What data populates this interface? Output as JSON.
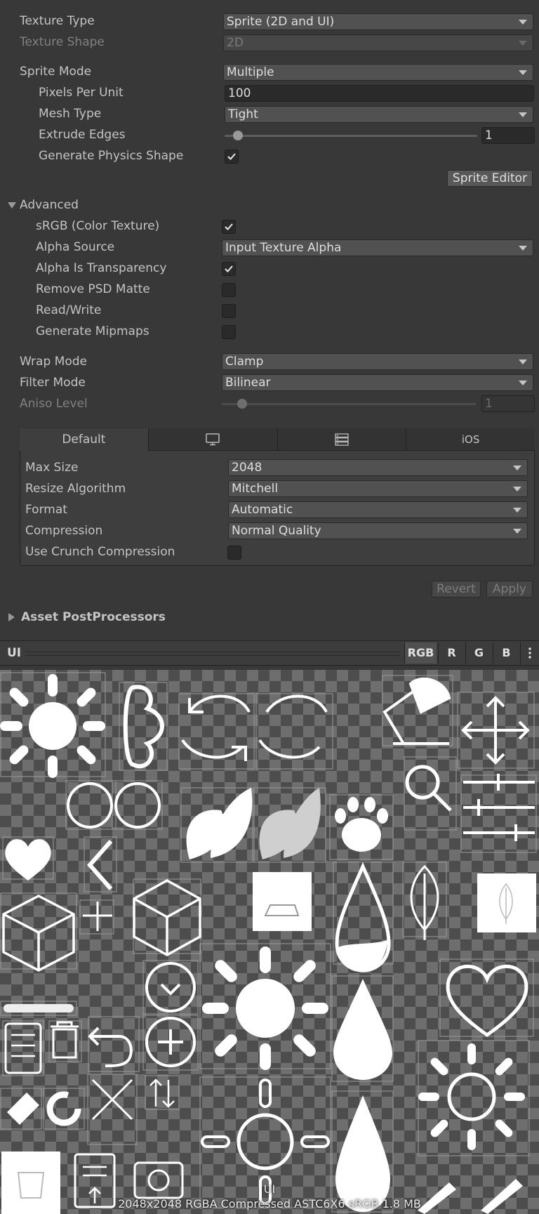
{
  "importer": {
    "texture_type": {
      "label": "Texture Type",
      "value": "Sprite (2D and UI)"
    },
    "texture_shape": {
      "label": "Texture Shape",
      "value": "2D"
    },
    "sprite_mode": {
      "label": "Sprite Mode",
      "value": "Multiple"
    },
    "pixels_per_unit": {
      "label": "Pixels Per Unit",
      "value": "100"
    },
    "mesh_type": {
      "label": "Mesh Type",
      "value": "Tight"
    },
    "extrude_edges": {
      "label": "Extrude Edges",
      "value": "1",
      "slider_fraction": 0.05
    },
    "generate_physics_shape": {
      "label": "Generate Physics Shape",
      "checked": true
    },
    "sprite_editor_button": "Sprite Editor"
  },
  "advanced": {
    "title": "Advanced",
    "srgb": {
      "label": "sRGB (Color Texture)",
      "checked": true
    },
    "alpha_source": {
      "label": "Alpha Source",
      "value": "Input Texture Alpha"
    },
    "alpha_is_transparency": {
      "label": "Alpha Is Transparency",
      "checked": true
    },
    "remove_psd_matte": {
      "label": "Remove PSD Matte",
      "checked": false
    },
    "read_write": {
      "label": "Read/Write",
      "checked": false
    },
    "generate_mipmaps": {
      "label": "Generate Mipmaps",
      "checked": false
    }
  },
  "wrap_mode": {
    "label": "Wrap Mode",
    "value": "Clamp"
  },
  "filter_mode": {
    "label": "Filter Mode",
    "value": "Bilinear"
  },
  "aniso_level": {
    "label": "Aniso Level",
    "value": "1",
    "slider_fraction": 0.08
  },
  "platform": {
    "tabs": [
      {
        "label": "Default",
        "icon": "none"
      },
      {
        "label": "",
        "icon": "monitor-icon"
      },
      {
        "label": "",
        "icon": "server-icon"
      },
      {
        "label": "iOS",
        "icon": "none"
      }
    ],
    "max_size": {
      "label": "Max Size",
      "value": "2048"
    },
    "resize_algorithm": {
      "label": "Resize Algorithm",
      "value": "Mitchell"
    },
    "format": {
      "label": "Format",
      "value": "Automatic"
    },
    "compression": {
      "label": "Compression",
      "value": "Normal Quality"
    },
    "use_crunch": {
      "label": "Use Crunch Compression",
      "checked": false
    }
  },
  "actions": {
    "revert": "Revert",
    "apply": "Apply"
  },
  "asset_postprocessors": "Asset PostProcessors",
  "preview": {
    "title": "UI",
    "channels": [
      "RGB",
      "R",
      "G",
      "B"
    ],
    "image_label": "UI",
    "info": "2048x2048  RGBA Compressed ASTC6X6 sRGB  1.8 MB"
  }
}
